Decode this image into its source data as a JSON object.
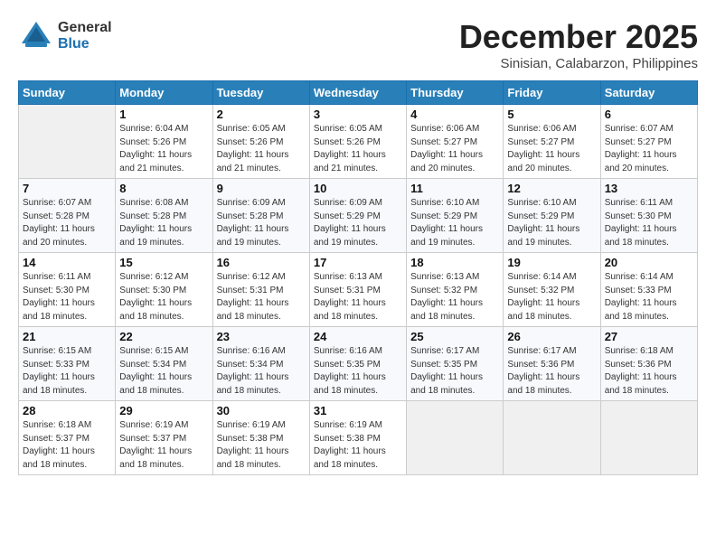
{
  "header": {
    "logo_general": "General",
    "logo_blue": "Blue",
    "month_title": "December 2025",
    "location": "Sinisian, Calabarzon, Philippines"
  },
  "days_of_week": [
    "Sunday",
    "Monday",
    "Tuesday",
    "Wednesday",
    "Thursday",
    "Friday",
    "Saturday"
  ],
  "weeks": [
    [
      {
        "day": "",
        "sunrise": "",
        "sunset": "",
        "daylight": ""
      },
      {
        "day": "1",
        "sunrise": "Sunrise: 6:04 AM",
        "sunset": "Sunset: 5:26 PM",
        "daylight": "Daylight: 11 hours and 21 minutes."
      },
      {
        "day": "2",
        "sunrise": "Sunrise: 6:05 AM",
        "sunset": "Sunset: 5:26 PM",
        "daylight": "Daylight: 11 hours and 21 minutes."
      },
      {
        "day": "3",
        "sunrise": "Sunrise: 6:05 AM",
        "sunset": "Sunset: 5:26 PM",
        "daylight": "Daylight: 11 hours and 21 minutes."
      },
      {
        "day": "4",
        "sunrise": "Sunrise: 6:06 AM",
        "sunset": "Sunset: 5:27 PM",
        "daylight": "Daylight: 11 hours and 20 minutes."
      },
      {
        "day": "5",
        "sunrise": "Sunrise: 6:06 AM",
        "sunset": "Sunset: 5:27 PM",
        "daylight": "Daylight: 11 hours and 20 minutes."
      },
      {
        "day": "6",
        "sunrise": "Sunrise: 6:07 AM",
        "sunset": "Sunset: 5:27 PM",
        "daylight": "Daylight: 11 hours and 20 minutes."
      }
    ],
    [
      {
        "day": "7",
        "sunrise": "Sunrise: 6:07 AM",
        "sunset": "Sunset: 5:28 PM",
        "daylight": "Daylight: 11 hours and 20 minutes."
      },
      {
        "day": "8",
        "sunrise": "Sunrise: 6:08 AM",
        "sunset": "Sunset: 5:28 PM",
        "daylight": "Daylight: 11 hours and 19 minutes."
      },
      {
        "day": "9",
        "sunrise": "Sunrise: 6:09 AM",
        "sunset": "Sunset: 5:28 PM",
        "daylight": "Daylight: 11 hours and 19 minutes."
      },
      {
        "day": "10",
        "sunrise": "Sunrise: 6:09 AM",
        "sunset": "Sunset: 5:29 PM",
        "daylight": "Daylight: 11 hours and 19 minutes."
      },
      {
        "day": "11",
        "sunrise": "Sunrise: 6:10 AM",
        "sunset": "Sunset: 5:29 PM",
        "daylight": "Daylight: 11 hours and 19 minutes."
      },
      {
        "day": "12",
        "sunrise": "Sunrise: 6:10 AM",
        "sunset": "Sunset: 5:29 PM",
        "daylight": "Daylight: 11 hours and 19 minutes."
      },
      {
        "day": "13",
        "sunrise": "Sunrise: 6:11 AM",
        "sunset": "Sunset: 5:30 PM",
        "daylight": "Daylight: 11 hours and 18 minutes."
      }
    ],
    [
      {
        "day": "14",
        "sunrise": "Sunrise: 6:11 AM",
        "sunset": "Sunset: 5:30 PM",
        "daylight": "Daylight: 11 hours and 18 minutes."
      },
      {
        "day": "15",
        "sunrise": "Sunrise: 6:12 AM",
        "sunset": "Sunset: 5:30 PM",
        "daylight": "Daylight: 11 hours and 18 minutes."
      },
      {
        "day": "16",
        "sunrise": "Sunrise: 6:12 AM",
        "sunset": "Sunset: 5:31 PM",
        "daylight": "Daylight: 11 hours and 18 minutes."
      },
      {
        "day": "17",
        "sunrise": "Sunrise: 6:13 AM",
        "sunset": "Sunset: 5:31 PM",
        "daylight": "Daylight: 11 hours and 18 minutes."
      },
      {
        "day": "18",
        "sunrise": "Sunrise: 6:13 AM",
        "sunset": "Sunset: 5:32 PM",
        "daylight": "Daylight: 11 hours and 18 minutes."
      },
      {
        "day": "19",
        "sunrise": "Sunrise: 6:14 AM",
        "sunset": "Sunset: 5:32 PM",
        "daylight": "Daylight: 11 hours and 18 minutes."
      },
      {
        "day": "20",
        "sunrise": "Sunrise: 6:14 AM",
        "sunset": "Sunset: 5:33 PM",
        "daylight": "Daylight: 11 hours and 18 minutes."
      }
    ],
    [
      {
        "day": "21",
        "sunrise": "Sunrise: 6:15 AM",
        "sunset": "Sunset: 5:33 PM",
        "daylight": "Daylight: 11 hours and 18 minutes."
      },
      {
        "day": "22",
        "sunrise": "Sunrise: 6:15 AM",
        "sunset": "Sunset: 5:34 PM",
        "daylight": "Daylight: 11 hours and 18 minutes."
      },
      {
        "day": "23",
        "sunrise": "Sunrise: 6:16 AM",
        "sunset": "Sunset: 5:34 PM",
        "daylight": "Daylight: 11 hours and 18 minutes."
      },
      {
        "day": "24",
        "sunrise": "Sunrise: 6:16 AM",
        "sunset": "Sunset: 5:35 PM",
        "daylight": "Daylight: 11 hours and 18 minutes."
      },
      {
        "day": "25",
        "sunrise": "Sunrise: 6:17 AM",
        "sunset": "Sunset: 5:35 PM",
        "daylight": "Daylight: 11 hours and 18 minutes."
      },
      {
        "day": "26",
        "sunrise": "Sunrise: 6:17 AM",
        "sunset": "Sunset: 5:36 PM",
        "daylight": "Daylight: 11 hours and 18 minutes."
      },
      {
        "day": "27",
        "sunrise": "Sunrise: 6:18 AM",
        "sunset": "Sunset: 5:36 PM",
        "daylight": "Daylight: 11 hours and 18 minutes."
      }
    ],
    [
      {
        "day": "28",
        "sunrise": "Sunrise: 6:18 AM",
        "sunset": "Sunset: 5:37 PM",
        "daylight": "Daylight: 11 hours and 18 minutes."
      },
      {
        "day": "29",
        "sunrise": "Sunrise: 6:19 AM",
        "sunset": "Sunset: 5:37 PM",
        "daylight": "Daylight: 11 hours and 18 minutes."
      },
      {
        "day": "30",
        "sunrise": "Sunrise: 6:19 AM",
        "sunset": "Sunset: 5:38 PM",
        "daylight": "Daylight: 11 hours and 18 minutes."
      },
      {
        "day": "31",
        "sunrise": "Sunrise: 6:19 AM",
        "sunset": "Sunset: 5:38 PM",
        "daylight": "Daylight: 11 hours and 18 minutes."
      },
      {
        "day": "",
        "sunrise": "",
        "sunset": "",
        "daylight": ""
      },
      {
        "day": "",
        "sunrise": "",
        "sunset": "",
        "daylight": ""
      },
      {
        "day": "",
        "sunrise": "",
        "sunset": "",
        "daylight": ""
      }
    ]
  ]
}
